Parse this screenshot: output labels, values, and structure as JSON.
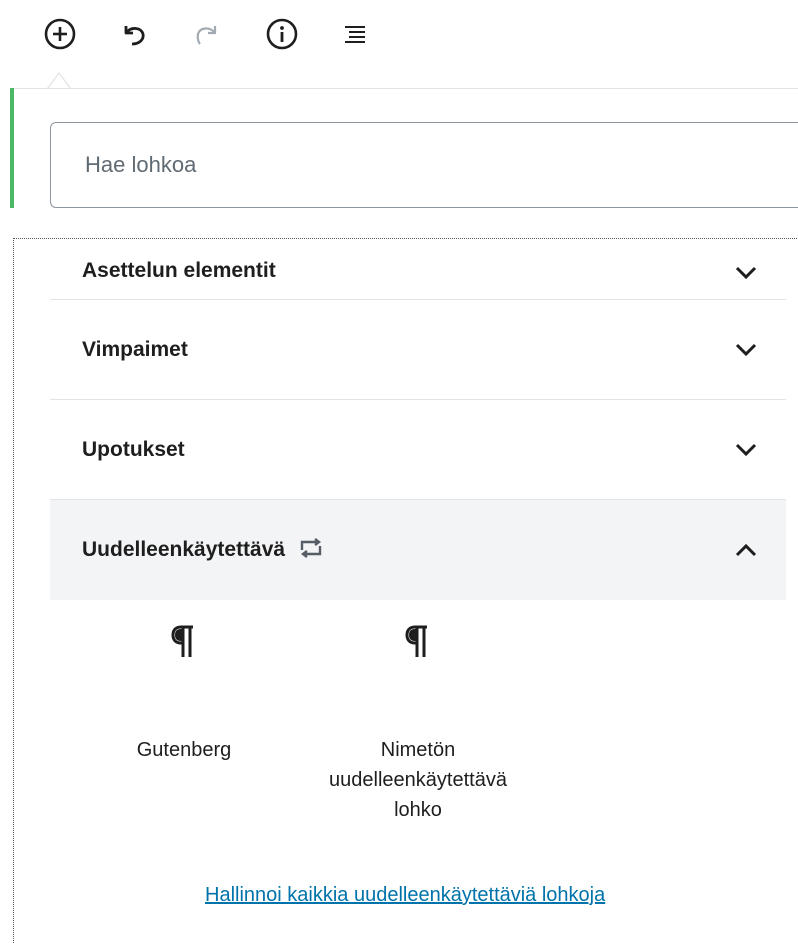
{
  "toolbar": {
    "buttons": [
      {
        "name": "add-block",
        "icon": "plus-circle-icon"
      },
      {
        "name": "undo",
        "icon": "undo-icon"
      },
      {
        "name": "redo",
        "icon": "redo-icon",
        "disabled": true
      },
      {
        "name": "info",
        "icon": "info-icon"
      },
      {
        "name": "block-navigation",
        "icon": "list-outline-icon"
      }
    ]
  },
  "inserter": {
    "search": {
      "placeholder": "Hae lohkoa",
      "value": ""
    },
    "panels": [
      {
        "title": "Asettelun elementit",
        "expanded": false
      },
      {
        "title": "Vimpaimet",
        "expanded": false
      },
      {
        "title": "Upotukset",
        "expanded": false
      },
      {
        "title": "Uudelleenkäytettävä",
        "expanded": true,
        "icon": "reusable-block-icon"
      }
    ],
    "reusable_blocks": [
      {
        "label": "Gutenberg",
        "icon": "paragraph-icon"
      },
      {
        "label": "Nimetön uudelleenkäytettävä lohko",
        "icon": "paragraph-icon"
      }
    ],
    "manage_link": "Hallinnoi kaikkia uudelleenkäytettäviä lohkoja"
  },
  "colors": {
    "accent_green": "#4ab866",
    "link": "#0073aa",
    "panel_open_bg": "#f3f4f5",
    "text": "#1e1e1e",
    "disabled_icon": "#a2aab2"
  }
}
